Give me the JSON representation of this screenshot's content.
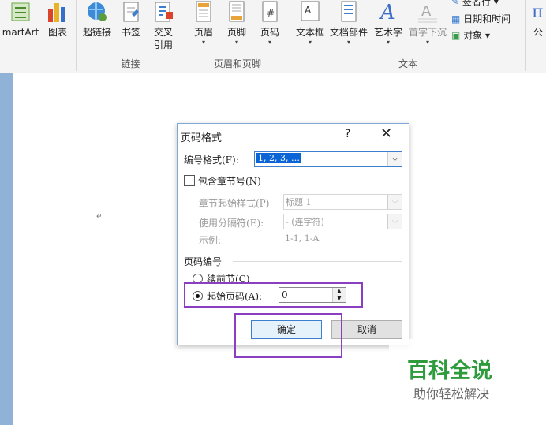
{
  "ribbon": {
    "buttons": [
      {
        "label": "martArt"
      },
      {
        "label": "图表"
      },
      {
        "label": "超链接"
      },
      {
        "label": "书签"
      },
      {
        "label": "交叉",
        "label2": "引用"
      },
      {
        "label": "页眉"
      },
      {
        "label": "页脚"
      },
      {
        "label": "页码"
      },
      {
        "label": "文本框"
      },
      {
        "label": "文档部件"
      },
      {
        "label": "艺术字"
      },
      {
        "label": "首字下沉"
      },
      {
        "label": "签名行"
      },
      {
        "label": "日期和时间"
      },
      {
        "label": "对象"
      },
      {
        "label": "公"
      }
    ],
    "groups": {
      "links": "链接",
      "header_footer": "页眉和页脚",
      "text": "文本"
    }
  },
  "dialog": {
    "title": "页码格式",
    "help": "?",
    "close": "✕",
    "number_format_label": "编号格式(F):",
    "number_format_value": "1, 2, 3, …",
    "include_chapter_label": "包含章节号(N)",
    "chapter_style_label": "章节起始样式(P)",
    "chapter_style_value": "标题 1",
    "separator_label": "使用分隔符(E):",
    "separator_value": "-   (连字符)",
    "example_label": "示例:",
    "example_value": "1-1, 1-A",
    "page_numbering_label": "页码编号",
    "continue_label": "续前节(C)",
    "start_at_label": "起始页码(A):",
    "start_at_value": "0",
    "ok": "确定",
    "cancel": "取消"
  },
  "watermark": {
    "title": "百科全说",
    "subtitle": "助你轻松解决"
  },
  "colors": {
    "highlight": "#8a3fc2",
    "selection": "#0a64d6",
    "watermark": "#2e9c3c"
  }
}
